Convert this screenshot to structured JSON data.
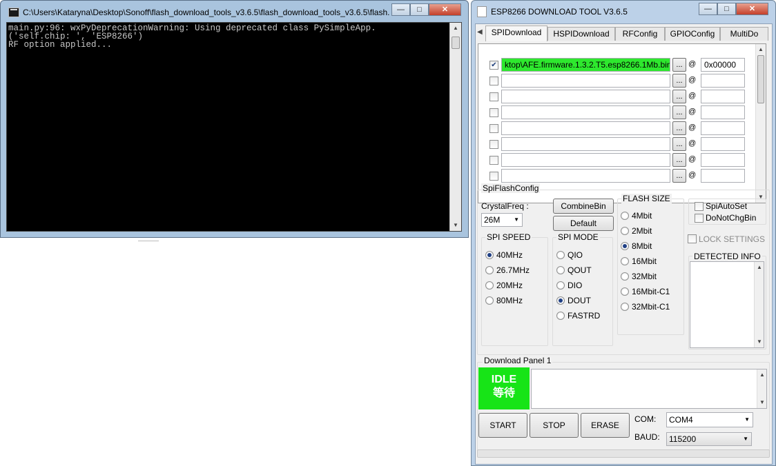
{
  "console": {
    "title": "C:\\Users\\Kataryna\\Desktop\\Sonoff\\flash_download_tools_v3.6.5\\flash_download_tools_v3.6.5\\flash...",
    "lines": [
      "main.py:96: wxPyDeprecationWarning: Using deprecated class PySimpleApp.",
      "('self.chip: ', 'ESP8266')",
      "RF option applied..."
    ],
    "buttons": {
      "minimize": "—",
      "maximize": "□",
      "close": "✕"
    }
  },
  "esp": {
    "title": "ESP8266 DOWNLOAD TOOL V3.6.5",
    "buttons": {
      "minimize": "—",
      "maximize": "□",
      "close": "✕"
    },
    "tabs": [
      "SPIDownload",
      "HSPIDownload",
      "RFConfig",
      "GPIOConfig",
      "MultiDo"
    ],
    "active_tab": "SPIDownload",
    "files": [
      {
        "checked": true,
        "path": "ktop\\AFE.firmware.1.3.2.T5.esp8266.1Mb.bin",
        "address": "0x00000"
      },
      {
        "checked": false,
        "path": "",
        "address": ""
      },
      {
        "checked": false,
        "path": "",
        "address": ""
      },
      {
        "checked": false,
        "path": "",
        "address": ""
      },
      {
        "checked": false,
        "path": "",
        "address": ""
      },
      {
        "checked": false,
        "path": "",
        "address": ""
      },
      {
        "checked": false,
        "path": "",
        "address": ""
      },
      {
        "checked": false,
        "path": "",
        "address": ""
      }
    ],
    "browse_label": "...",
    "at_label": "@",
    "spi_flash_config": {
      "label": "SpiFlashConfig",
      "crystal_label": "CrystalFreq :",
      "crystal_value": "26M",
      "combine_label": "CombineBin",
      "default_label": "Default",
      "spi_speed": {
        "label": "SPI SPEED",
        "options": [
          "40MHz",
          "26.7MHz",
          "20MHz",
          "80MHz"
        ],
        "selected": "40MHz"
      },
      "spi_mode": {
        "label": "SPI MODE",
        "options": [
          "QIO",
          "QOUT",
          "DIO",
          "DOUT",
          "FASTRD"
        ],
        "selected": "DOUT"
      },
      "flash_size": {
        "label": "FLASH SIZE",
        "options": [
          "4Mbit",
          "2Mbit",
          "8Mbit",
          "16Mbit",
          "32Mbit",
          "16Mbit-C1",
          "32Mbit-C1"
        ],
        "selected": "8Mbit"
      },
      "spi_auto_set": "SpiAutoSet",
      "do_not_chg_bin": "DoNotChgBin",
      "lock_settings": "LOCK SETTINGS",
      "detected_info": "DETECTED INFO"
    },
    "download_panel": {
      "label": "Download Panel 1",
      "status_en": "IDLE",
      "status_cn": "等待",
      "status_color": "#17e417",
      "start": "START",
      "stop": "STOP",
      "erase": "ERASE",
      "com_label": "COM:",
      "com_value": "COM4",
      "baud_label": "BAUD:",
      "baud_value": "115200"
    }
  }
}
